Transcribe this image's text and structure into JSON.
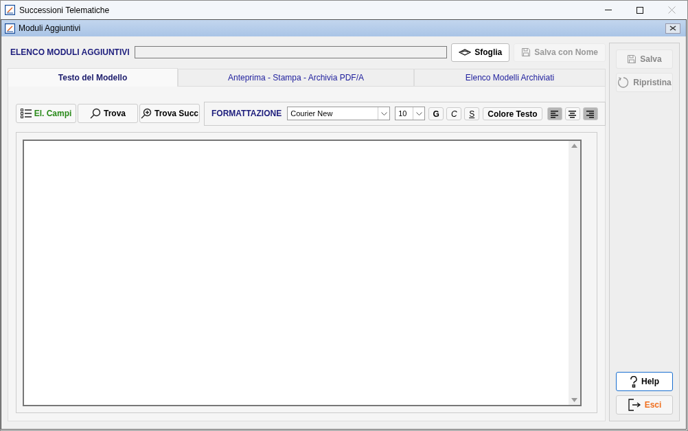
{
  "app_window": {
    "title": "Successioni Telematiche"
  },
  "dialog": {
    "title": "Moduli Aggiuntivi"
  },
  "modules": {
    "label": "ELENCO MODULI AGGIUNTIVI"
  },
  "top_buttons": [
    {
      "kind": "browse",
      "label": "Sfoglia",
      "disabled": false
    },
    {
      "kind": "save",
      "label": "Salva con Nome",
      "disabled": true
    }
  ],
  "tabs": [
    {
      "label": "Testo del Modello",
      "selected": true
    },
    {
      "label": "Anteprima - Stampa - Archivia PDF/A",
      "selected": false
    },
    {
      "label": "Elenco Modelli Archiviati",
      "selected": false
    }
  ],
  "tools": [
    {
      "kind": "list",
      "label": "El. Campi"
    },
    {
      "kind": "search",
      "label": "Trova"
    },
    {
      "kind": "search-next",
      "label": "Trova Succ"
    }
  ],
  "formatting": {
    "label": "FORMATTAZIONE",
    "font": "Courier New",
    "size": "10",
    "styles": [
      {
        "kind": "bold",
        "label": "G"
      },
      {
        "kind": "italic",
        "label": "C"
      },
      {
        "kind": "underline",
        "label": "S"
      }
    ],
    "color_button": "Colore Testo",
    "alignments": [
      {
        "kind": "left",
        "selected": true
      },
      {
        "kind": "center",
        "selected": false
      },
      {
        "kind": "right",
        "selected": true
      }
    ]
  },
  "side_buttons": [
    {
      "kind": "save",
      "label": "Salva",
      "disabled": true
    },
    {
      "kind": "restore",
      "label": "Ripristina",
      "disabled": true
    },
    {
      "kind": "help",
      "label": "Help",
      "disabled": false,
      "focused": true
    },
    {
      "kind": "exit",
      "label": "Esci",
      "disabled": false,
      "focused": false
    }
  ]
}
